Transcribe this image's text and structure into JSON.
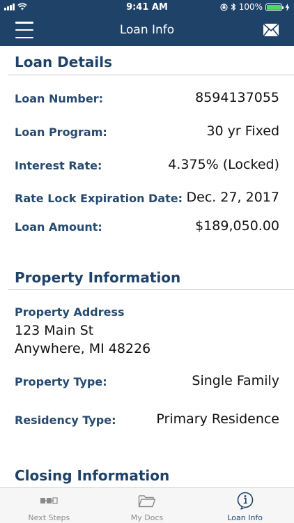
{
  "status": {
    "time": "9:41 AM",
    "battery": "100%",
    "battery_level": 1.0
  },
  "nav": {
    "title": "Loan Info",
    "menu_icon": "hamburger-icon",
    "mail_icon": "mail-icon"
  },
  "loan_details": {
    "title": "Loan Details",
    "rows": [
      {
        "label": "Loan Number:",
        "value": "8594137055"
      },
      {
        "label": "Loan Program:",
        "value": "30 yr Fixed"
      },
      {
        "label": "Interest Rate:",
        "value": "4.375% (Locked)"
      },
      {
        "label": "Rate Lock Expiration Date:",
        "value": "Dec. 27, 2017"
      },
      {
        "label": "Loan Amount:",
        "value": "$189,050.00"
      }
    ]
  },
  "property": {
    "title": "Property Information",
    "address_label": "Property Address",
    "address_line1": "123 Main St",
    "address_line2": "Anywhere, MI 48226",
    "rows": [
      {
        "label": "Property Type:",
        "value": "Single Family"
      },
      {
        "label": "Residency Type:",
        "value": "Primary Residence"
      }
    ]
  },
  "closing": {
    "title": "Closing Information"
  },
  "tabs": [
    {
      "label": "Next Steps",
      "icon": "steps-icon",
      "active": false
    },
    {
      "label": "My Docs",
      "icon": "folder-icon",
      "active": false
    },
    {
      "label": "Loan Info",
      "icon": "info-icon",
      "active": true
    }
  ],
  "colors": {
    "brand": "#1f4268",
    "label": "#274a70",
    "tab_inactive": "#8a8a8a"
  }
}
